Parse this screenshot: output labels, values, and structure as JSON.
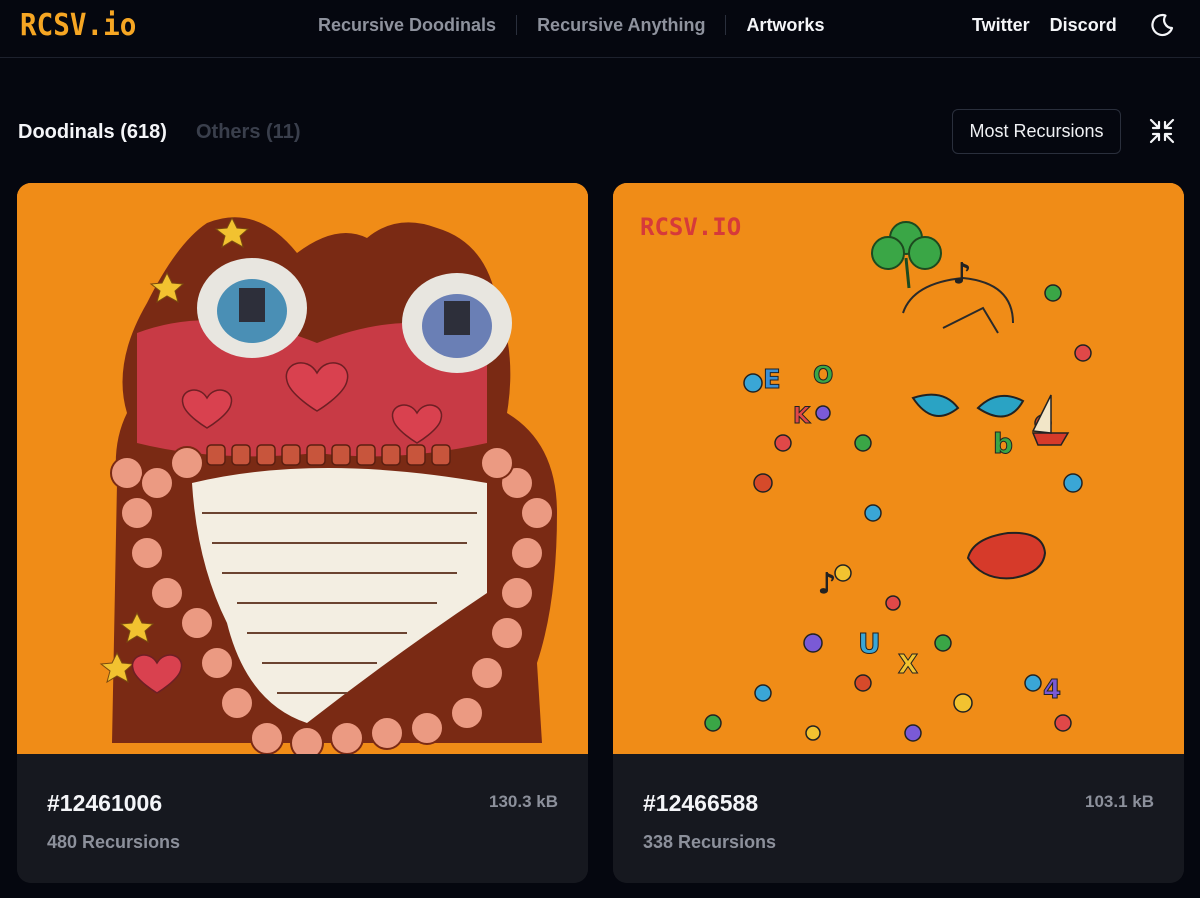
{
  "header": {
    "logo": "RCSV.io",
    "nav": [
      {
        "label": "Recursive Doodinals"
      },
      {
        "label": "Recursive Anything"
      },
      {
        "label": "Artworks"
      }
    ],
    "social": [
      {
        "label": "Twitter"
      },
      {
        "label": "Discord"
      }
    ],
    "theme_icon": "moon-icon"
  },
  "filters": {
    "tabs": [
      {
        "label": "Doodinals (618)",
        "active": true
      },
      {
        "label": "Others (11)",
        "active": false
      }
    ],
    "sort_label": "Most Recursions",
    "collapse_icon": "collapse-icon"
  },
  "cards": [
    {
      "id": "#12461006",
      "size": "130.3 kB",
      "recursions": "480 Recursions"
    },
    {
      "id": "#12466588",
      "size": "103.1 kB",
      "recursions": "338 Recursions",
      "watermark": "RCSV.IO"
    }
  ],
  "colors": {
    "background": "#05070f",
    "accent": "#f6a623",
    "card_bg": "#16181f",
    "art_bg": "#f08c17"
  }
}
